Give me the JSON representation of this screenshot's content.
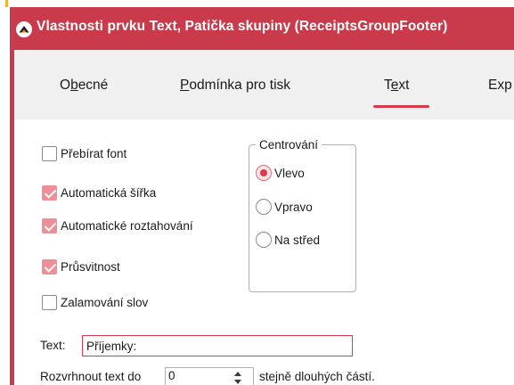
{
  "window": {
    "title": "Vlastnosti prvku Text, Patička skupiny (ReceiptsGroupFooter)",
    "accent_color": "#c93a4a",
    "icon": "app-logo-icon"
  },
  "tabs": [
    {
      "label": "Obecné",
      "mnemonic_index": 1,
      "active": false
    },
    {
      "label": "Podmínka pro tisk",
      "mnemonic_index": 0,
      "active": false
    },
    {
      "label": "Text",
      "mnemonic_index": 1,
      "active": true
    },
    {
      "label": "Exp",
      "active": false
    }
  ],
  "tab_labels": {
    "obecne_pre": "O",
    "obecne_u": "b",
    "obecne_post": "ecné",
    "podminka_u": "P",
    "podminka_post": "odmínka pro tisk",
    "text_pre": "T",
    "text_u": "e",
    "text_post": "xt",
    "exp": "Exp"
  },
  "checkboxes": [
    {
      "label": "Přebírat font",
      "checked": false
    },
    {
      "label": "Automatická šířka",
      "checked": true
    },
    {
      "label": "Automatické roztahování",
      "checked": true
    },
    {
      "label": "Průsvitnost",
      "checked": true
    },
    {
      "label": "Zalamování slov",
      "checked": false
    }
  ],
  "alignment_group": {
    "legend": "Centrování",
    "options": [
      {
        "label": "Vlevo",
        "selected": true
      },
      {
        "label": "Vpravo",
        "selected": false
      },
      {
        "label": "Na střed",
        "selected": false
      }
    ]
  },
  "text_field": {
    "label": "Text:",
    "value": "Příjemky:"
  },
  "split_row": {
    "label_before": "Rozvrhnout text do",
    "value": "0",
    "label_after": "stejně dlouhých částí."
  },
  "colors": {
    "checked_fill": "#ee8f98",
    "radio_selected": "#d9394c",
    "active_tab_underline": "#d9394c",
    "focused_input_border": "#d9394c"
  }
}
